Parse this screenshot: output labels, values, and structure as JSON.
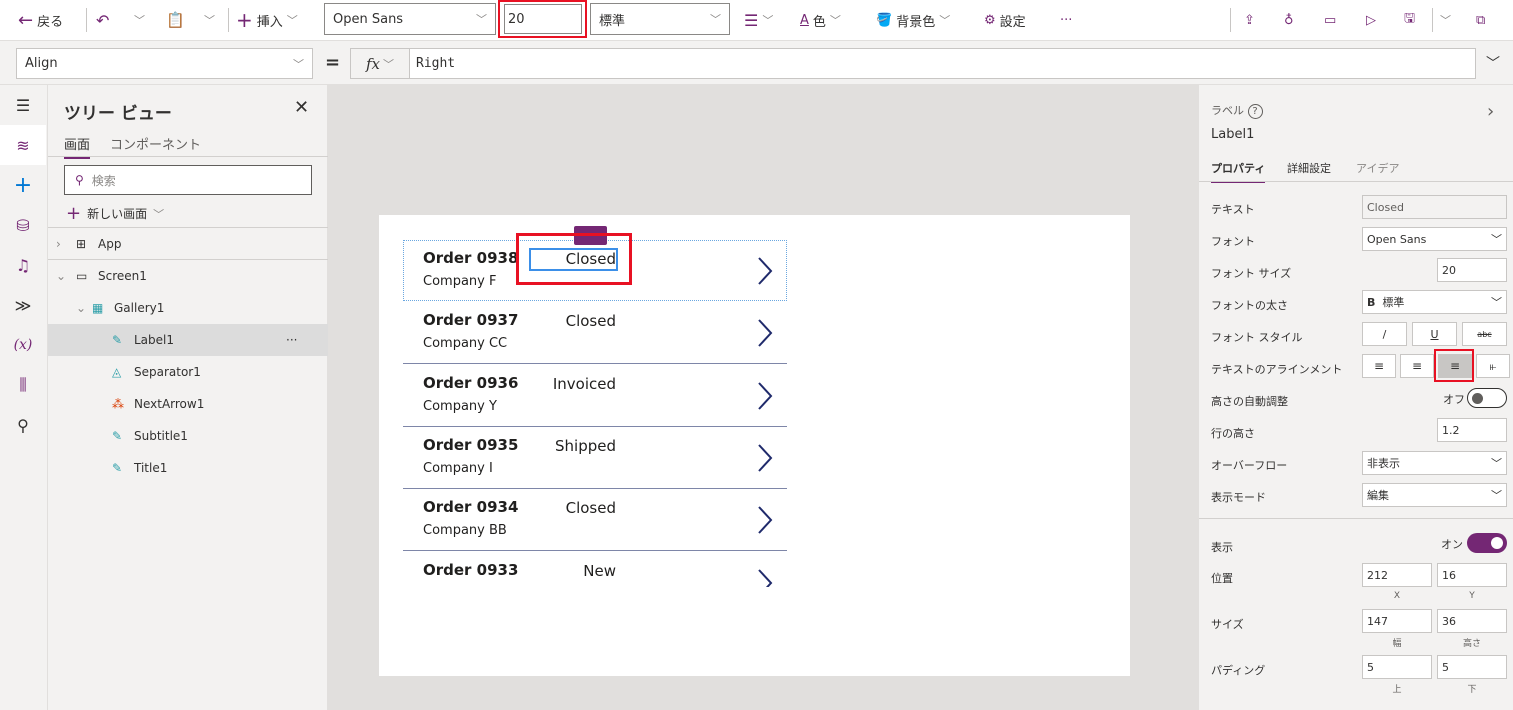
{
  "toolbar": {
    "back": "戻る",
    "insert": "挿入",
    "font": "Open Sans",
    "font_size": "20",
    "font_weight": "標準",
    "color": "色",
    "fill": "背景色",
    "settings": "設定",
    "more": "···"
  },
  "formula": {
    "property": "Align",
    "equals": "=",
    "fx": "fx",
    "value": "Right"
  },
  "tree": {
    "title": "ツリー ビュー",
    "tabs": [
      "画面",
      "コンポーネント"
    ],
    "search_placeholder": "検索",
    "new_screen": "新しい画面",
    "items": [
      {
        "label": "App"
      },
      {
        "label": "Screen1"
      },
      {
        "label": "Gallery1"
      },
      {
        "label": "Label1",
        "more": "···"
      },
      {
        "label": "Separator1"
      },
      {
        "label": "NextArrow1"
      },
      {
        "label": "Subtitle1"
      },
      {
        "label": "Title1"
      }
    ]
  },
  "gallery": [
    {
      "title": "Order 0938",
      "subtitle": "Company F",
      "status": "Closed"
    },
    {
      "title": "Order 0937",
      "subtitle": "Company CC",
      "status": "Closed"
    },
    {
      "title": "Order 0936",
      "subtitle": "Company Y",
      "status": "Invoiced"
    },
    {
      "title": "Order 0935",
      "subtitle": "Company I",
      "status": "Shipped"
    },
    {
      "title": "Order 0934",
      "subtitle": "Company BB",
      "status": "Closed"
    },
    {
      "title": "Order 0933",
      "subtitle": "",
      "status": "New"
    }
  ],
  "props": {
    "type": "ラベル",
    "name": "Label1",
    "tabs": [
      "プロパティ",
      "詳細設定",
      "アイデア"
    ],
    "text_label": "テキスト",
    "text": "Closed",
    "font_label": "フォント",
    "font": "Open Sans",
    "size_label": "フォント サイズ",
    "size": "20",
    "weight_label": "フォントの太さ",
    "weight_b": "B",
    "weight": "標準",
    "style_label": "フォント スタイル",
    "italic": "/",
    "underline": "U",
    "strike": "abc",
    "align_label": "テキストのアラインメント",
    "autoheight_label": "高さの自動調整",
    "autoheight": "オフ",
    "lineheight_label": "行の高さ",
    "lineheight": "1.2",
    "overflow_label": "オーバーフロー",
    "overflow": "非表示",
    "mode_label": "表示モード",
    "mode": "編集",
    "visible_label": "表示",
    "visible": "オン",
    "pos_label": "位置",
    "x": "212",
    "y": "16",
    "x_cap": "X",
    "y_cap": "Y",
    "size2_label": "サイズ",
    "w": "147",
    "h": "36",
    "w_cap": "幅",
    "h_cap": "高さ",
    "pad_label": "パディング",
    "pt": "5",
    "pb": "5",
    "pt_cap": "上",
    "pb_cap": "下"
  },
  "colors": {
    "accent": "#742774",
    "highlight": "#e81123",
    "selection": "#3b8fe8"
  }
}
